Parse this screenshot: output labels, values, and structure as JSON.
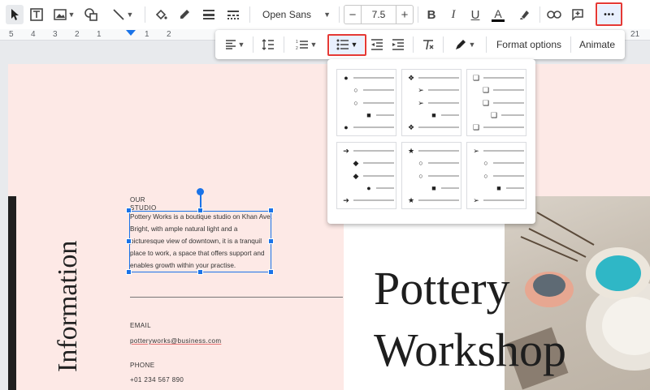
{
  "toolbar": {
    "font_name": "Open Sans",
    "font_size": "7.5",
    "minus": "−",
    "plus": "+",
    "bold": "B",
    "italic": "I",
    "underline": "U",
    "text_color": "A",
    "more": "•••"
  },
  "ruler": {
    "left_nums": [
      "5",
      "4",
      "3",
      "2",
      "1",
      "1",
      "2"
    ],
    "right_num": "21"
  },
  "format_popup": {
    "format_options": "Format options",
    "animate": "Animate"
  },
  "bullet_options": [
    {
      "rows": [
        "●",
        "○",
        "○",
        "■",
        "●"
      ]
    },
    {
      "rows": [
        "❖",
        "➢",
        "➢",
        "■",
        "❖"
      ]
    },
    {
      "rows": [
        "❑",
        "❑",
        "❑",
        "❑",
        "❑"
      ]
    },
    {
      "rows": [
        "➔",
        "◆",
        "◆",
        "●",
        "➔"
      ]
    },
    {
      "rows": [
        "★",
        "○",
        "○",
        "■",
        "★"
      ]
    },
    {
      "rows": [
        "➢",
        "○",
        "○",
        "■",
        "➢"
      ]
    }
  ],
  "slide": {
    "vertical_title": "Information",
    "studio_label_1": "OUR",
    "studio_label_2": "STUDIO",
    "paragraph": "Pottery Works is a boutique studio on Khan Ave. Bright, with ample natural light and a picturesque view of downtown, it is a tranquil place to work, a space that offers support and enables growth within your practise.",
    "email_label": "EMAIL",
    "email_value": "potteryworks@business.com",
    "phone_label": "PHONE",
    "phone_value": "+01 234 567 890",
    "title_line1": "Pottery",
    "title_line2": "Workshop"
  },
  "colors": {
    "accent": "#1a73e8",
    "highlight": "#e53935",
    "slide_bg": "#fde9e6"
  }
}
